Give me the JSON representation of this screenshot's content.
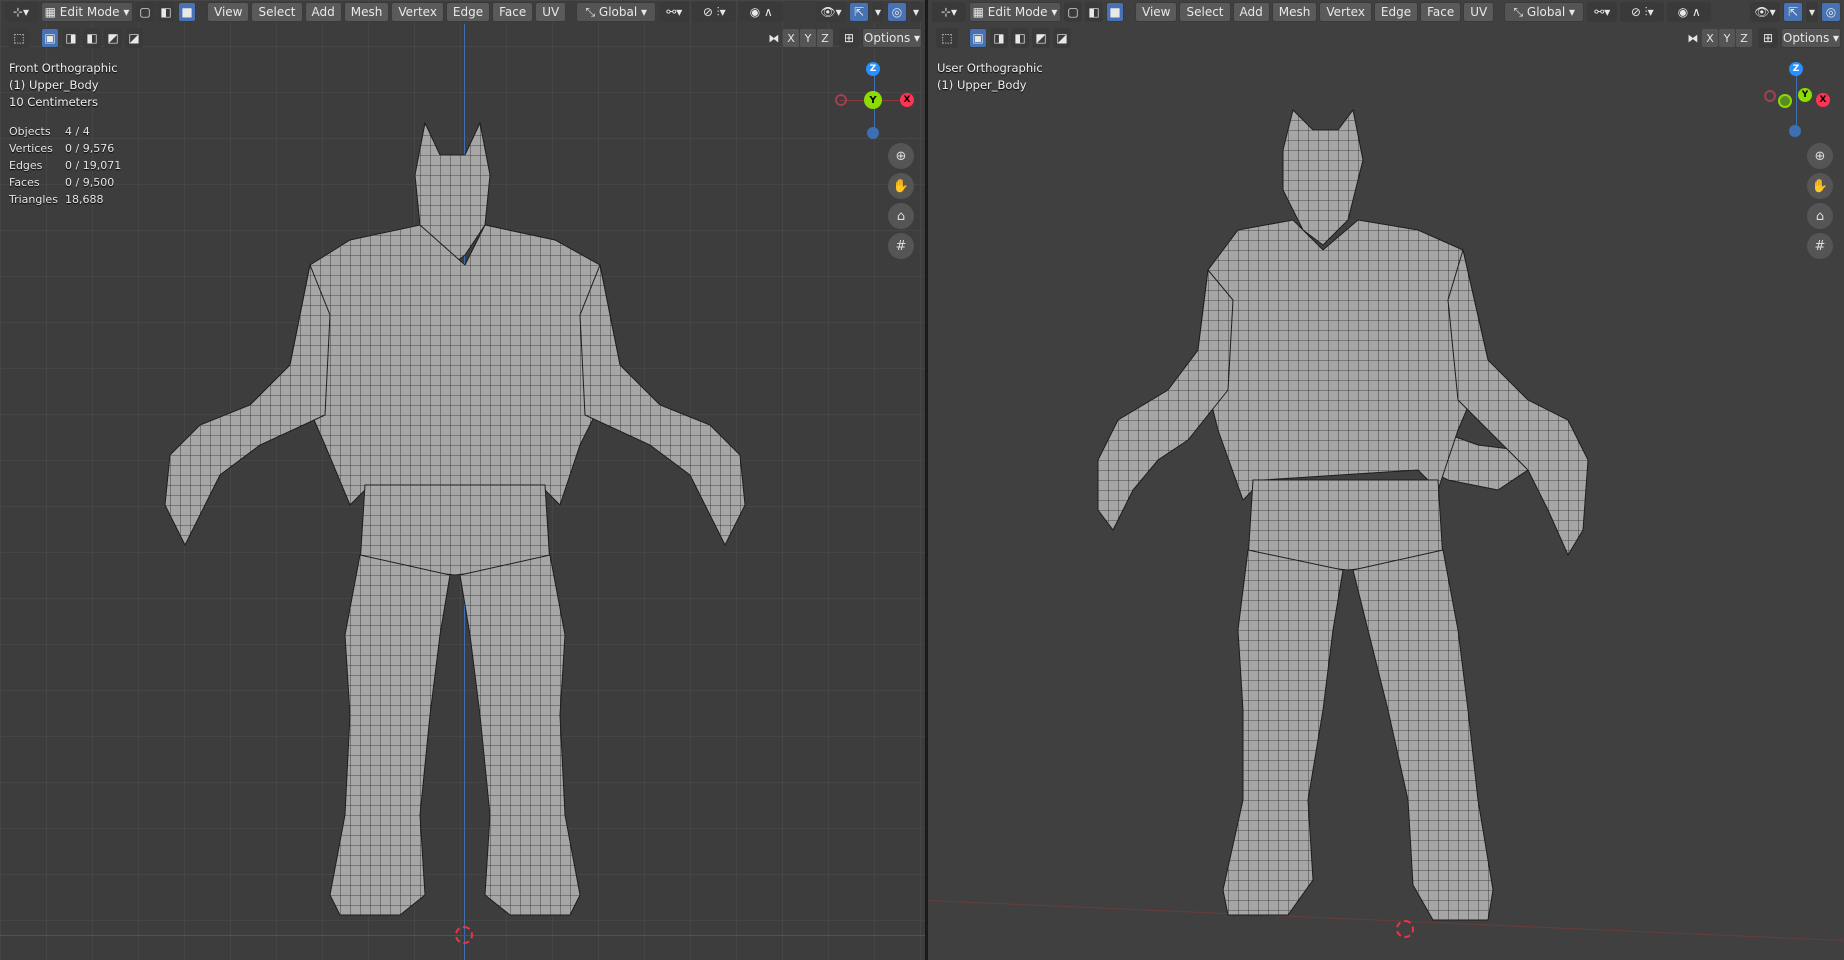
{
  "header": {
    "mode": "Edit Mode",
    "menus": [
      "View",
      "Select",
      "Add",
      "Mesh",
      "Vertex",
      "Edge",
      "Face",
      "UV"
    ],
    "orientation": "Global",
    "options": "Options",
    "axes": [
      "X",
      "Y",
      "Z"
    ]
  },
  "left_view": {
    "view_name": "Front Orthographic",
    "object": "(1) Upper_Body",
    "scale": "10 Centimeters",
    "stats": [
      {
        "label": "Objects",
        "value": "4 / 4"
      },
      {
        "label": "Vertices",
        "value": "0 / 9,576"
      },
      {
        "label": "Edges",
        "value": "0 / 19,071"
      },
      {
        "label": "Faces",
        "value": "0 / 9,500"
      },
      {
        "label": "Triangles",
        "value": "18,688"
      }
    ]
  },
  "right_view": {
    "view_name": "User Orthographic",
    "object": "(1) Upper_Body"
  },
  "gizmo": {
    "z": "Z",
    "y": "Y",
    "x": "X"
  },
  "colors": {
    "x": "#ff3352",
    "y": "#8bdc00",
    "z": "#2890ff",
    "accent": "#4772b3"
  }
}
